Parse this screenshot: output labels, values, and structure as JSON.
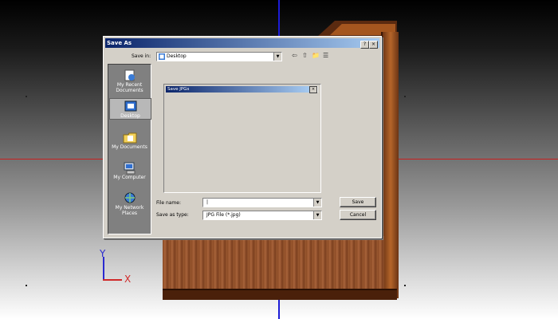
{
  "dialog": {
    "title": "Save As",
    "help_glyph": "?",
    "close_glyph": "×",
    "save_in_label": "Save in:",
    "save_in_value": "Desktop",
    "back_glyph": "⇦",
    "up_glyph": "⇧",
    "newfolder_glyph": "📁",
    "views_glyph": "☰",
    "file_name_label": "File name:",
    "file_name_value": "|",
    "save_as_type_label": "Save as type:",
    "save_as_type_value": "JPG File (*.jpg)",
    "save_button": "Save",
    "cancel_button": "Cancel",
    "inner_window": {
      "title": "Save JPGs",
      "close_glyph": "×"
    }
  },
  "places": [
    {
      "label": "My Recent Documents",
      "icon": "recent-documents-icon"
    },
    {
      "label": "Desktop",
      "icon": "desktop-icon",
      "selected": true
    },
    {
      "label": "My Documents",
      "icon": "my-documents-icon"
    },
    {
      "label": "My Computer",
      "icon": "my-computer-icon"
    },
    {
      "label": "My Network Places",
      "icon": "network-places-icon"
    }
  ],
  "gizmo": {
    "y_label": "Y",
    "x_label": "X"
  },
  "colors": {
    "axis_blue": "#1c1cd6",
    "axis_red": "#c81e1e",
    "titlebar": "#0a246a"
  }
}
